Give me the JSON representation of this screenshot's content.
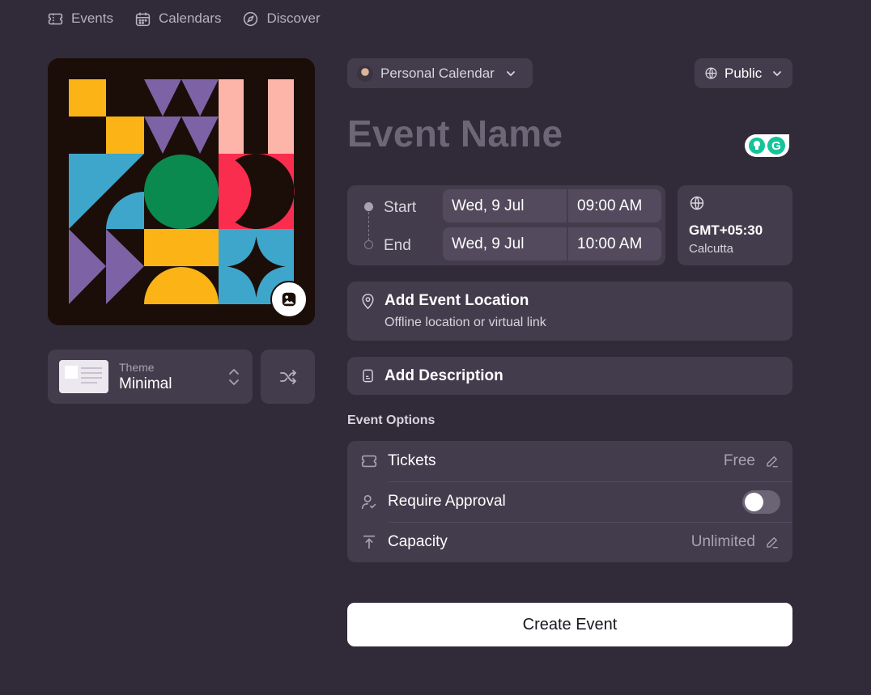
{
  "nav": {
    "items": [
      {
        "label": "Events",
        "icon": "ticket-icon"
      },
      {
        "label": "Calendars",
        "icon": "calendar-icon"
      },
      {
        "label": "Discover",
        "icon": "compass-icon"
      }
    ]
  },
  "cover": {
    "colors": {
      "bg": "#1b0e09",
      "yellow": "#fbb316",
      "purple": "#7d63a6",
      "pink": "#fdb5a9",
      "blue": "#3fa6cb",
      "green": "#0a8a4f",
      "red": "#fb2d4f"
    }
  },
  "theme": {
    "caption": "Theme",
    "name": "Minimal"
  },
  "calendar_selector": {
    "label": "Personal Calendar"
  },
  "visibility": {
    "label": "Public"
  },
  "event_name": {
    "placeholder": "Event Name"
  },
  "schedule": {
    "start": {
      "label": "Start",
      "date": "Wed, 9 Jul",
      "time": "09:00 AM"
    },
    "end": {
      "label": "End",
      "date": "Wed, 9 Jul",
      "time": "10:00 AM"
    }
  },
  "timezone": {
    "offset": "GMT+05:30",
    "city": "Calcutta"
  },
  "location": {
    "title": "Add Event Location",
    "subtitle": "Offline location or virtual link"
  },
  "description": {
    "label": "Add Description"
  },
  "options": {
    "heading": "Event Options",
    "tickets": {
      "label": "Tickets",
      "value": "Free"
    },
    "approval": {
      "label": "Require Approval",
      "enabled": false
    },
    "capacity": {
      "label": "Capacity",
      "value": "Unlimited"
    }
  },
  "create_button": {
    "label": "Create Event"
  },
  "colors": {
    "page_bg": "#302a39",
    "card_bg": "#433c4c",
    "field_bg": "#534b5d",
    "muted_text": "#a9a2b3",
    "grammarly": "#15c39a"
  }
}
